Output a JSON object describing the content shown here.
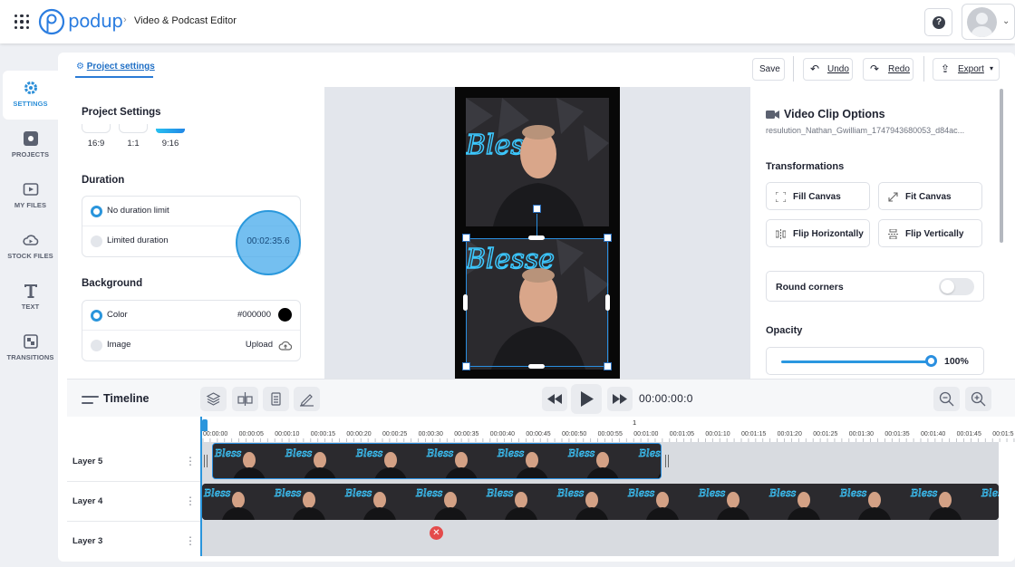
{
  "header": {
    "logo_text": "podup",
    "breadcrumb_sep": "›",
    "breadcrumb": "Video & Podcast Editor",
    "help_label": "?"
  },
  "rail": {
    "items": [
      {
        "label": "SETTINGS",
        "icon": "gear-icon",
        "active": true
      },
      {
        "label": "PROJECTS",
        "icon": "projects-icon",
        "active": false
      },
      {
        "label": "MY FILES",
        "icon": "files-icon",
        "active": false
      },
      {
        "label": "STOCK FILES",
        "icon": "cloud-icon",
        "active": false
      },
      {
        "label": "TEXT",
        "icon": "text-icon",
        "active": false
      },
      {
        "label": "TRANSITIONS",
        "icon": "transitions-icon",
        "active": false
      }
    ]
  },
  "toolbar": {
    "project_tab": "Project settings",
    "save": "Save",
    "undo": "Undo",
    "redo": "Redo",
    "export": "Export"
  },
  "settings": {
    "title": "Project Settings",
    "ratios": [
      "16:9",
      "1:1",
      "9:16"
    ],
    "active_ratio": "9:16",
    "duration_title": "Duration",
    "duration_options": [
      "No duration limit",
      "Limited duration"
    ],
    "duration_selected": "No duration limit",
    "duration_value": "00:02:35.6",
    "background_title": "Background",
    "bg_color_label": "Color",
    "bg_color_value": "#000000",
    "bg_image_label": "Image",
    "bg_upload_label": "Upload"
  },
  "clip_options": {
    "title": "Video Clip Options",
    "filename": "resulution_Nathan_Gwilliam_1747943680053_d84ac...",
    "transformations_title": "Transformations",
    "buttons": [
      "Fill Canvas",
      "Fit Canvas",
      "Flip Horizontally",
      "Flip Vertically"
    ],
    "round_corners_label": "Round corners",
    "round_corners_on": false,
    "opacity_title": "Opacity",
    "opacity_value": "100%",
    "opacity_level": 1.0
  },
  "timeline": {
    "title": "Timeline",
    "timecode": "00:00:00:0",
    "ruler_marker": "1",
    "ticks": [
      "00:00:00",
      "00:00:05",
      "00:00:10",
      "00:00:15",
      "00:00:20",
      "00:00:25",
      "00:00:30",
      "00:00:35",
      "00:00:40",
      "00:00:45",
      "00:00:50",
      "00:00:55",
      "00:01:00",
      "00:01:05",
      "00:01:10",
      "00:01:15",
      "00:01:20",
      "00:01:25",
      "00:01:30",
      "00:01:35",
      "00:01:40",
      "00:01:45",
      "00:01:5"
    ],
    "layers": [
      "Layer 5",
      "Layer 4",
      "Layer 3"
    ]
  },
  "colors": {
    "accent": "#2a95dc",
    "brand": "#2b7de0"
  }
}
